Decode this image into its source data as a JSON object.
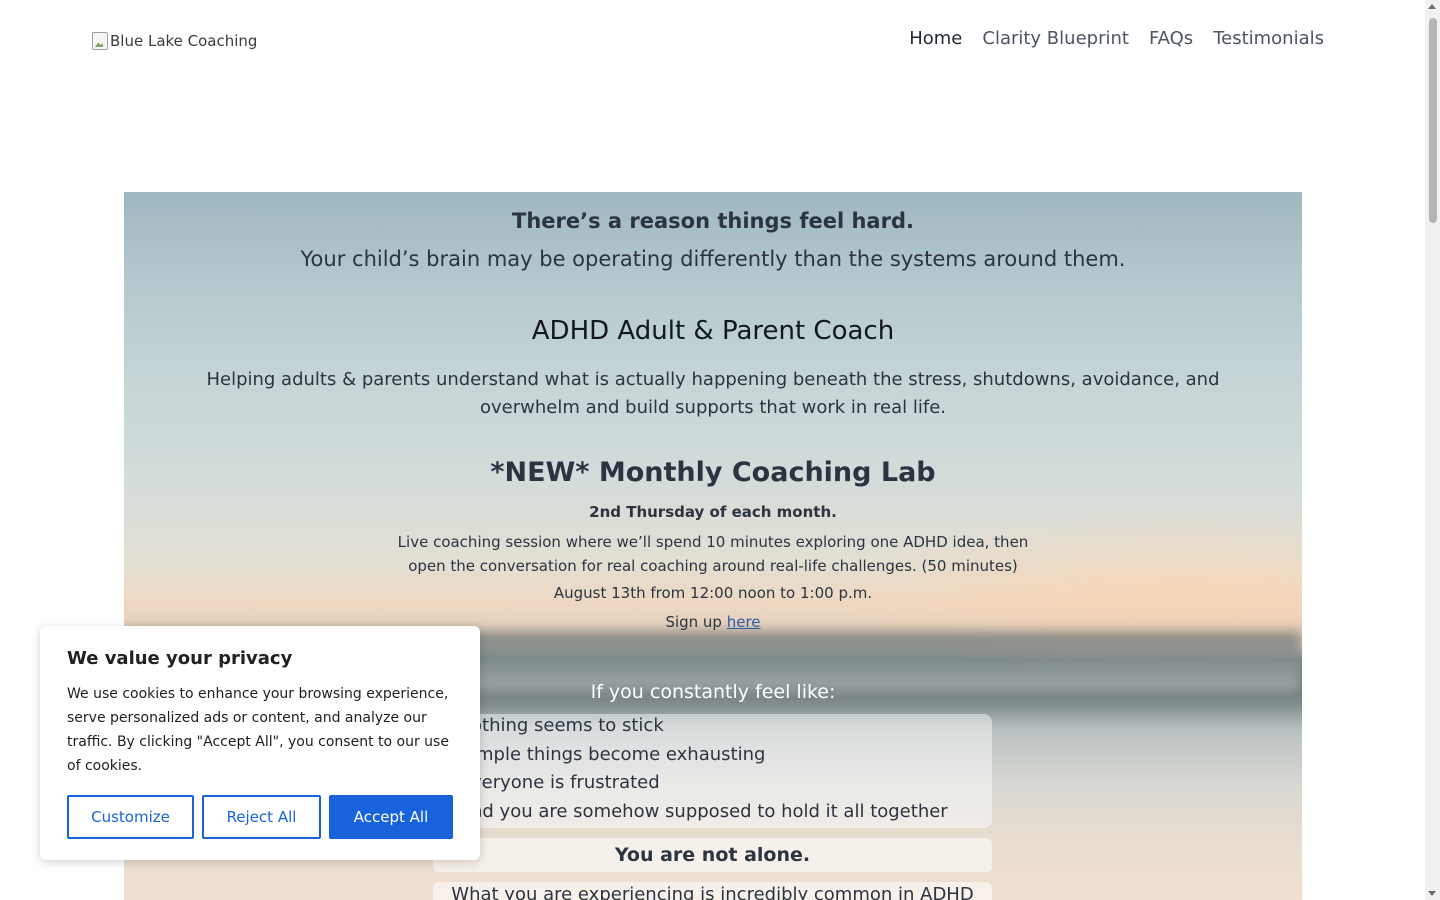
{
  "header": {
    "logo_alt": "Blue Lake Coaching",
    "nav": [
      "Home",
      "Clarity Blueprint",
      "FAQs",
      "Testimonials"
    ]
  },
  "hero": {
    "headline": "There’s a reason things feel hard.",
    "subheadline": "Your child’s brain may be operating differently than the systems around them.",
    "role_title": "ADHD Adult & Parent Coach",
    "description": "Helping adults & parents understand what is actually happening beneath the stress, shutdowns, avoidance, and overwhelm and build supports that work in real life.",
    "lab_title": "*NEW* Monthly Coaching Lab",
    "lab_schedule": "2nd Thursday of each month.",
    "lab_description": "Live coaching session where we’ll spend 10 minutes exploring one ADHD idea, then open the conversation for real coaching around real-life challenges. (50 minutes)",
    "lab_date": "August 13th from 12:00 noon to 1:00 p.m.",
    "signup_prefix": "Sign up ",
    "signup_link": "here",
    "feel_intro": "If you constantly feel like:",
    "feel_items": [
      "othing seems to stick",
      "imple things become exhausting",
      "veryone is frustrated",
      "nd you are somehow supposed to hold it all together"
    ],
    "not_alone": "You are not alone.",
    "common": "What you are experiencing is incredibly common in ADHD"
  },
  "cookie": {
    "title": "We value your privacy",
    "body": "We use cookies to enhance your browsing experience, serve personalized ads or content, and analyze our traffic. By clicking \"Accept All\", you consent to our use of cookies.",
    "customize": "Customize",
    "reject": "Reject All",
    "accept": "Accept All",
    "accent_color": "#1863dc"
  }
}
